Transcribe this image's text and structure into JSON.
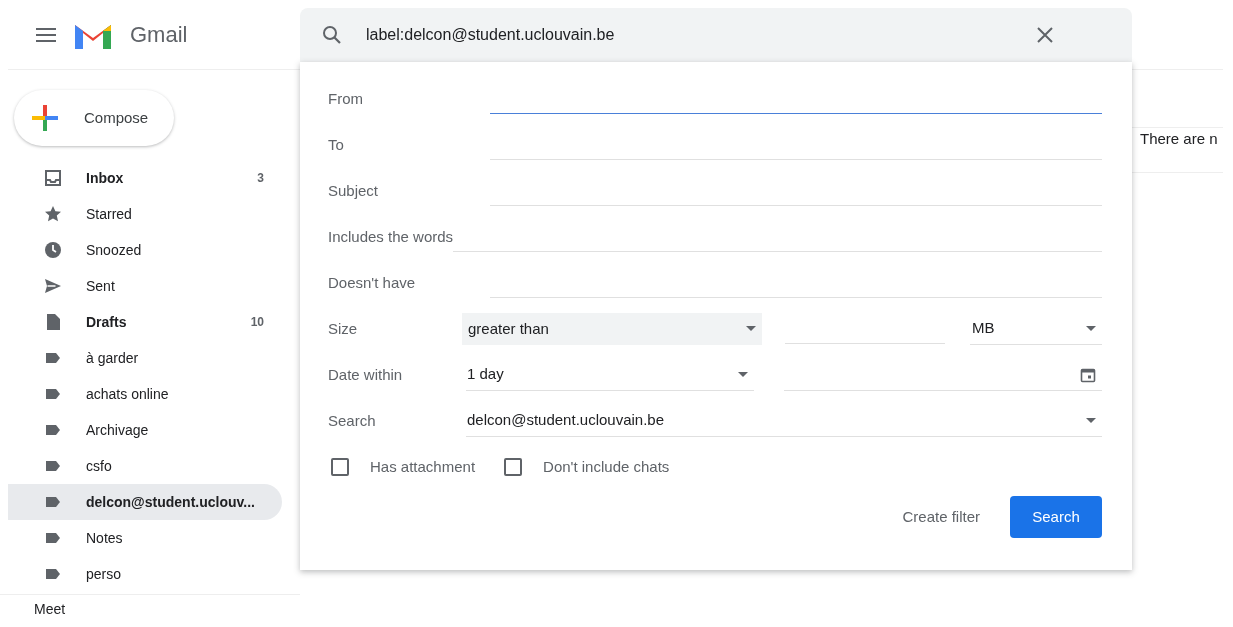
{
  "header": {
    "app_name": "Gmail"
  },
  "search": {
    "value": "label:delcon@student.uclouvain.be"
  },
  "compose": {
    "label": "Compose"
  },
  "sidebar": {
    "items": [
      {
        "kind": "inbox",
        "label": "Inbox",
        "count": "3",
        "unread": true,
        "selected": false
      },
      {
        "kind": "star",
        "label": "Starred",
        "unread": false,
        "selected": false
      },
      {
        "kind": "clock",
        "label": "Snoozed",
        "unread": false,
        "selected": false
      },
      {
        "kind": "send",
        "label": "Sent",
        "unread": false,
        "selected": false
      },
      {
        "kind": "file",
        "label": "Drafts",
        "count": "10",
        "unread": true,
        "selected": false
      },
      {
        "kind": "label",
        "label": "à garder",
        "unread": false,
        "selected": false
      },
      {
        "kind": "label",
        "label": "achats online",
        "unread": false,
        "selected": false
      },
      {
        "kind": "label",
        "label": "Archivage",
        "unread": false,
        "selected": false
      },
      {
        "kind": "label",
        "label": "csfo",
        "unread": false,
        "selected": false
      },
      {
        "kind": "label",
        "label": "delcon@student.uclouv...",
        "unread": true,
        "selected": true
      },
      {
        "kind": "label",
        "label": "Notes",
        "unread": false,
        "selected": false
      },
      {
        "kind": "label",
        "label": "perso",
        "unread": false,
        "selected": false
      }
    ],
    "footer": "Meet"
  },
  "main": {
    "message": "There are n"
  },
  "search_options": {
    "text_fields": [
      {
        "label": "From",
        "focused": true
      },
      {
        "label": "To",
        "focused": false
      },
      {
        "label": "Subject",
        "focused": false
      },
      {
        "label": "Includes the words",
        "focused": false
      },
      {
        "label": "Doesn't have",
        "focused": false
      }
    ],
    "size": {
      "label": "Size",
      "operator": "greater than",
      "unit": "MB"
    },
    "date": {
      "label": "Date within",
      "value": "1 day"
    },
    "search_in": {
      "label": "Search",
      "value": "delcon@student.uclouvain.be"
    },
    "checkboxes": [
      {
        "label": "Has attachment",
        "checked": false
      },
      {
        "label": "Don't include chats",
        "checked": false
      }
    ],
    "buttons": {
      "create_filter": "Create filter",
      "search": "Search"
    }
  }
}
